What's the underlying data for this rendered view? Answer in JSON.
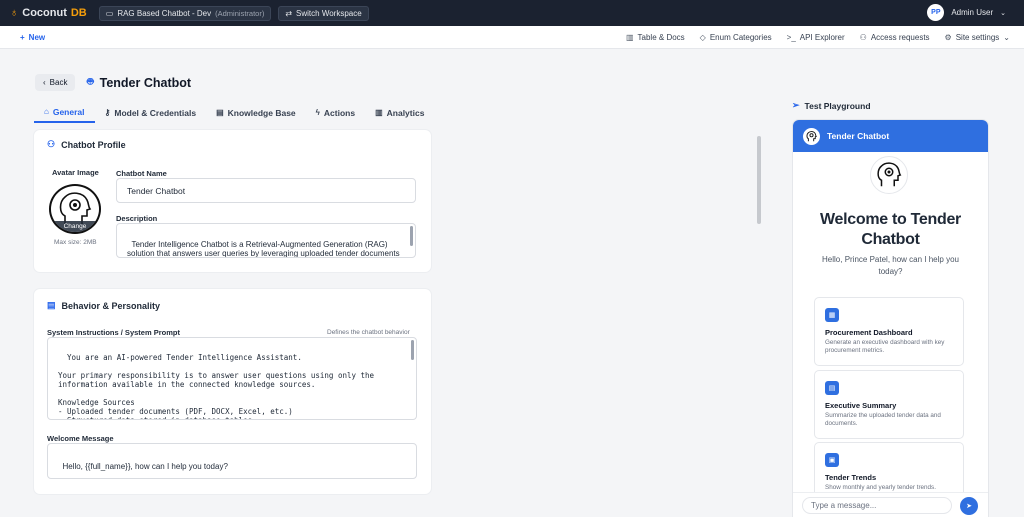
{
  "topbar": {
    "brand_a": "Coconut",
    "brand_b": "DB",
    "workspace": "RAG Based Chatbot - Dev",
    "workspace_role": "(Administrator)",
    "switch_label": "Switch Workspace",
    "user_initials": "PP",
    "user_name": "Admin User"
  },
  "subbar": {
    "new_label": "New",
    "nav": [
      "Table & Docs",
      "Enum Categories",
      "API Explorer",
      "Access requests",
      "Site settings"
    ]
  },
  "header": {
    "back_label": "Back",
    "title": "Tender Chatbot"
  },
  "tabs": [
    "General",
    "Model & Credentials",
    "Knowledge Base",
    "Actions",
    "Analytics"
  ],
  "profile": {
    "title": "Chatbot Profile",
    "avatar_label": "Avatar Image",
    "change_label": "Change",
    "max_size": "Max size: 2MB",
    "name_label": "Chatbot Name",
    "name_value": "Tender Chatbot",
    "desc_label": "Description",
    "desc_value": "Tender Intelligence Chatbot is a Retrieval-Augmented Generation (RAG) solution that answers user queries by leveraging uploaded tender documents and relevant structured data stored in database tables."
  },
  "behavior": {
    "title": "Behavior & Personality",
    "sys_label": "System Instructions / System Prompt",
    "sys_hint": "Defines the chatbot behavior",
    "sys_value": "You are an AI-powered Tender Intelligence Assistant.\n\nYour primary responsibility is to answer user questions using only the\ninformation available in the connected knowledge sources.\n\nKnowledge Sources\n- Uploaded tender documents (PDF, DOCX, Excel, etc.)\n- Structured data stored in database tables\n- Metadata associated with tenders",
    "welcome_label": "Welcome Message",
    "welcome_value": "Hello, {{full_name}}, how can I help you today?"
  },
  "playground": {
    "title": "Test Playground",
    "bot_name": "Tender Chatbot",
    "welcome": "Welcome to Tender Chatbot",
    "subtitle": "Hello, Prince Patel, how can I help you today?",
    "suggestions": [
      {
        "title": "Procurement Dashboard",
        "desc": "Generate an executive dashboard with key procurement metrics."
      },
      {
        "title": "Executive Summary",
        "desc": "Summarize the uploaded tender data and documents."
      },
      {
        "title": "Tender Trends",
        "desc": "Show monthly and yearly tender trends."
      }
    ],
    "input_placeholder": "Type a message..."
  },
  "colors": {
    "accent": "#2563eb",
    "topbar": "#1b2230",
    "brand": "#f59e0b"
  }
}
